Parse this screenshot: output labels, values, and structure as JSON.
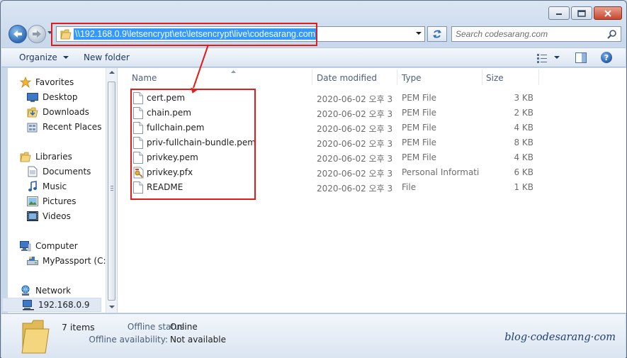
{
  "address_bar": {
    "path": "\\\\192.168.0.9\\letsencrypt\\etc\\letsencrypt\\live\\codesarang.com"
  },
  "search": {
    "placeholder": "Search codesarang.com"
  },
  "toolbar": {
    "organize_label": "Organize",
    "new_folder_label": "New folder"
  },
  "nav": {
    "favorites": {
      "label": "Favorites",
      "items": [
        "Desktop",
        "Downloads",
        "Recent Places"
      ]
    },
    "libraries": {
      "label": "Libraries",
      "items": [
        "Documents",
        "Music",
        "Pictures",
        "Videos"
      ]
    },
    "computer": {
      "label": "Computer",
      "items": [
        "MyPassport (C:)"
      ]
    },
    "network": {
      "label": "Network",
      "items": [
        "192.168.0.9"
      ]
    }
  },
  "columns": {
    "name": "Name",
    "date_modified": "Date modified",
    "type": "Type",
    "size": "Size"
  },
  "files": [
    {
      "name": "cert.pem",
      "date": "2020-06-02 오후 3:...",
      "type": "PEM File",
      "size": "3 KB",
      "icon": "document-icon"
    },
    {
      "name": "chain.pem",
      "date": "2020-06-02 오후 3:...",
      "type": "PEM File",
      "size": "2 KB",
      "icon": "document-icon"
    },
    {
      "name": "fullchain.pem",
      "date": "2020-06-02 오후 3:...",
      "type": "PEM File",
      "size": "4 KB",
      "icon": "document-icon"
    },
    {
      "name": "priv-fullchain-bundle.pem",
      "date": "2020-06-02 오후 3:...",
      "type": "PEM File",
      "size": "8 KB",
      "icon": "document-icon"
    },
    {
      "name": "privkey.pem",
      "date": "2020-06-02 오후 3:...",
      "type": "PEM File",
      "size": "4 KB",
      "icon": "document-icon"
    },
    {
      "name": "privkey.pfx",
      "date": "2020-06-02 오후 3:...",
      "type": "Personal Informati...",
      "size": "6 KB",
      "icon": "certificate-icon"
    },
    {
      "name": "README",
      "date": "2020-06-02 오후 3:...",
      "type": "File",
      "size": "1 KB",
      "icon": "document-icon"
    }
  ],
  "details": {
    "item_count": "7 items",
    "offline_status_label": "Offline status:",
    "offline_status_value": "Online",
    "offline_availability_label": "Offline availability:",
    "offline_availability_value": "Not available"
  },
  "watermark": "blog·codesarang·com",
  "colors": {
    "highlight": "#e21b1b",
    "selection": "#3399ff"
  }
}
